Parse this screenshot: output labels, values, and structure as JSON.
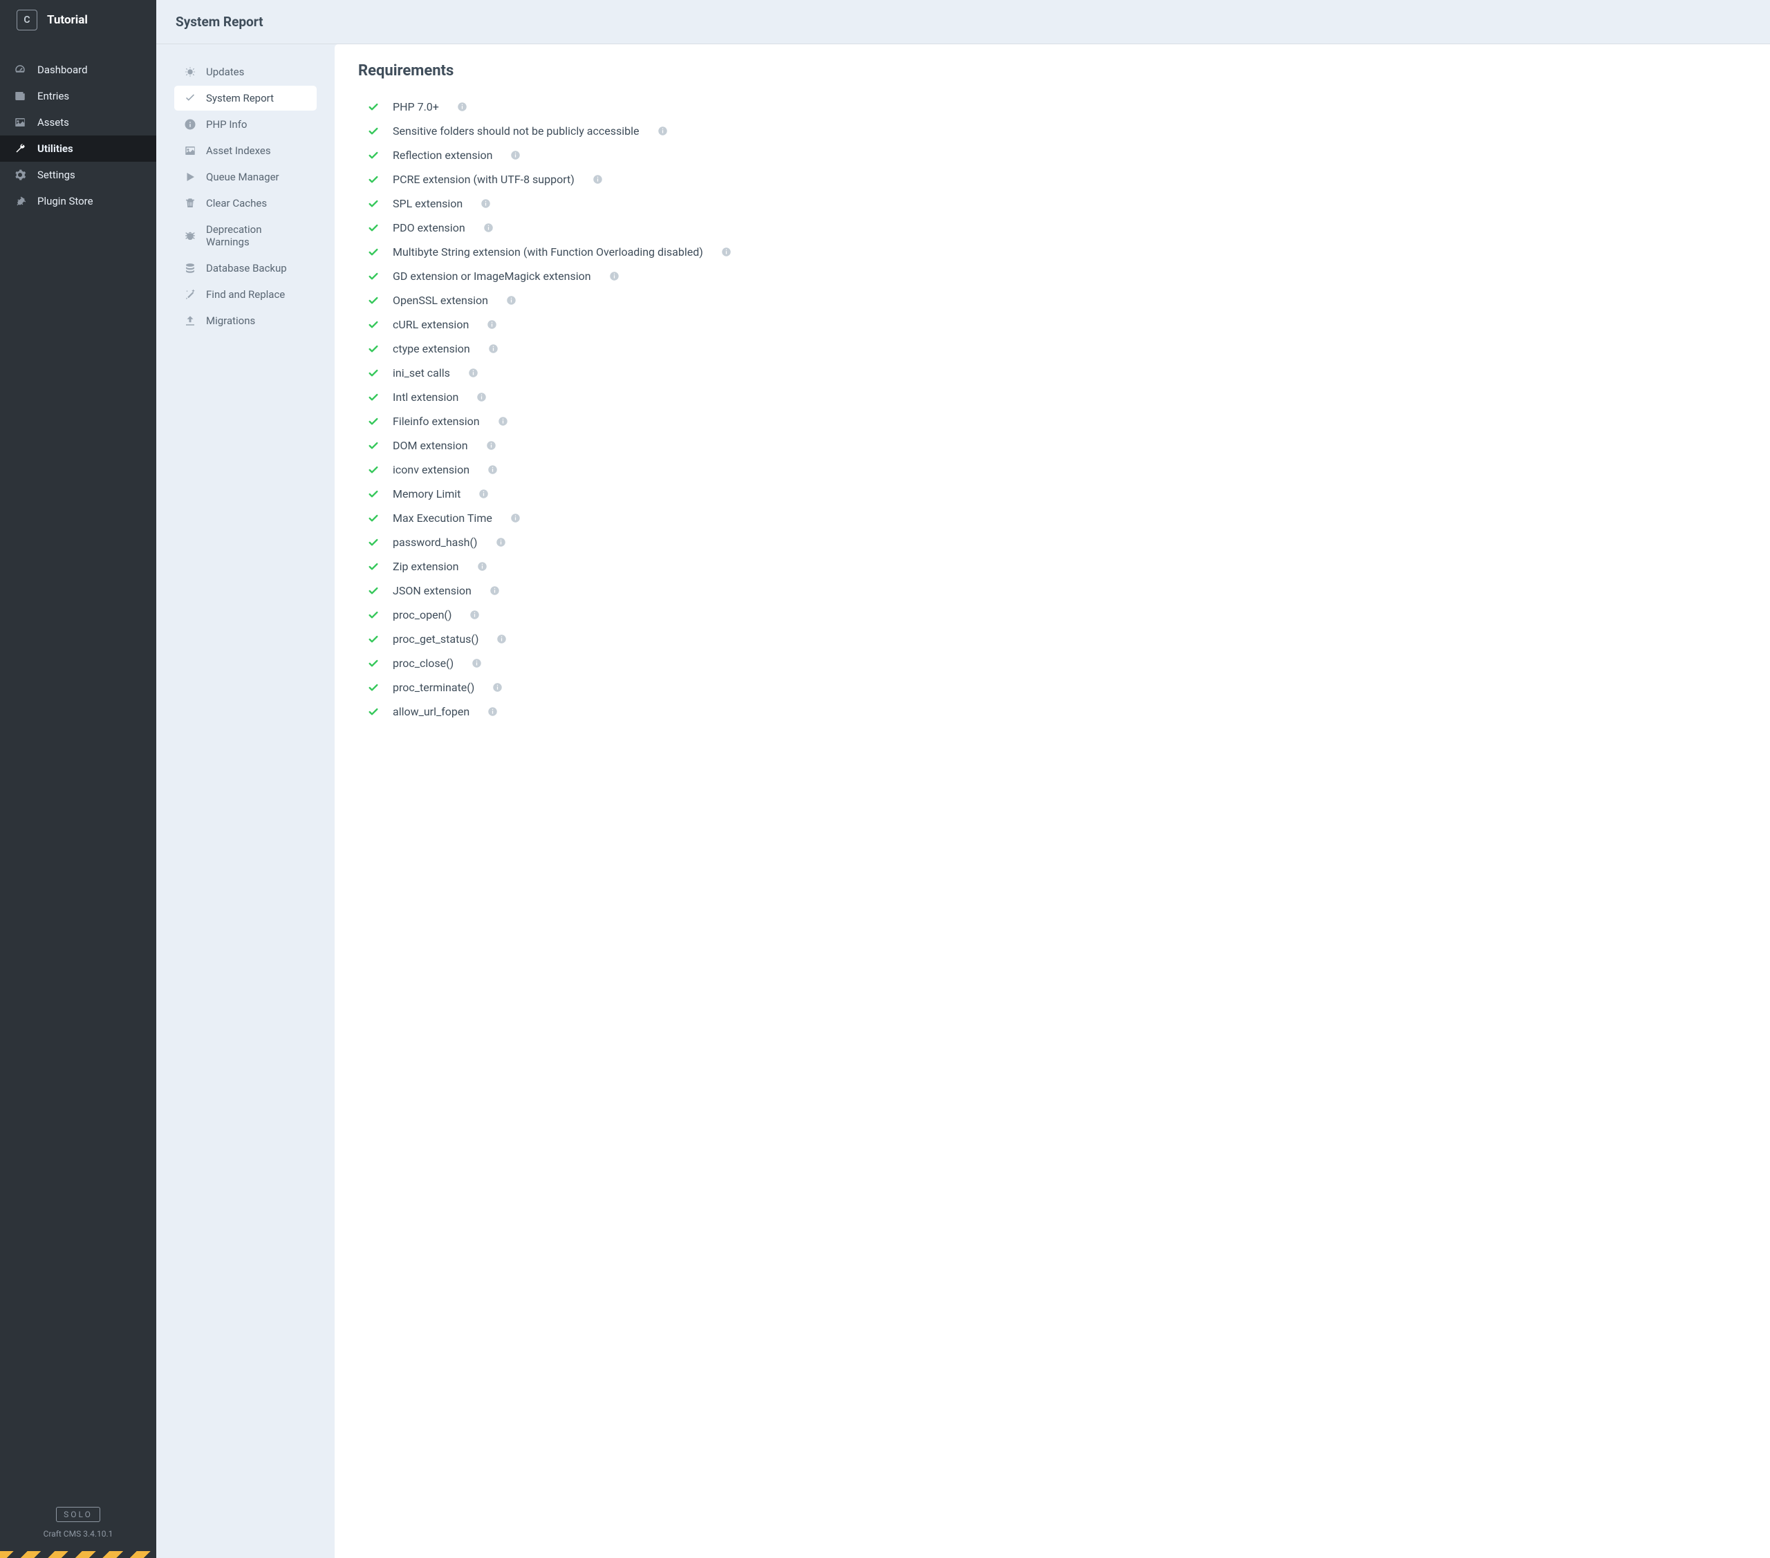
{
  "site": {
    "logo_letter": "C",
    "name": "Tutorial"
  },
  "nav": {
    "items": [
      {
        "label": "Dashboard",
        "icon": "gauge"
      },
      {
        "label": "Entries",
        "icon": "news"
      },
      {
        "label": "Assets",
        "icon": "image"
      },
      {
        "label": "Utilities",
        "icon": "wrench",
        "active": true
      },
      {
        "label": "Settings",
        "icon": "gear"
      },
      {
        "label": "Plugin Store",
        "icon": "plug"
      }
    ]
  },
  "footer": {
    "edition": "SOLO",
    "version": "Craft CMS 3.4.10.1"
  },
  "page": {
    "title": "System Report"
  },
  "subnav": {
    "items": [
      {
        "label": "Updates",
        "icon": "sun"
      },
      {
        "label": "System Report",
        "icon": "check",
        "active": true
      },
      {
        "label": "PHP Info",
        "icon": "info"
      },
      {
        "label": "Asset Indexes",
        "icon": "image"
      },
      {
        "label": "Queue Manager",
        "icon": "play"
      },
      {
        "label": "Clear Caches",
        "icon": "trash"
      },
      {
        "label": "Deprecation Warnings",
        "icon": "bug"
      },
      {
        "label": "Database Backup",
        "icon": "database"
      },
      {
        "label": "Find and Replace",
        "icon": "wand"
      },
      {
        "label": "Migrations",
        "icon": "upload"
      }
    ]
  },
  "content": {
    "section_title": "Requirements",
    "requirements": [
      {
        "label": "PHP 7.0+",
        "ok": true
      },
      {
        "label": "Sensitive folders should not be publicly accessible",
        "ok": true
      },
      {
        "label": "Reflection extension",
        "ok": true
      },
      {
        "label": "PCRE extension (with UTF-8 support)",
        "ok": true
      },
      {
        "label": "SPL extension",
        "ok": true
      },
      {
        "label": "PDO extension",
        "ok": true
      },
      {
        "label": "Multibyte String extension (with Function Overloading disabled)",
        "ok": true
      },
      {
        "label": "GD extension or ImageMagick extension",
        "ok": true
      },
      {
        "label": "OpenSSL extension",
        "ok": true
      },
      {
        "label": "cURL extension",
        "ok": true
      },
      {
        "label": "ctype extension",
        "ok": true
      },
      {
        "label": "ini_set calls",
        "ok": true
      },
      {
        "label": "Intl extension",
        "ok": true
      },
      {
        "label": "Fileinfo extension",
        "ok": true
      },
      {
        "label": "DOM extension",
        "ok": true
      },
      {
        "label": "iconv extension",
        "ok": true
      },
      {
        "label": "Memory Limit",
        "ok": true
      },
      {
        "label": "Max Execution Time",
        "ok": true
      },
      {
        "label": "password_hash()",
        "ok": true
      },
      {
        "label": "Zip extension",
        "ok": true
      },
      {
        "label": "JSON extension",
        "ok": true
      },
      {
        "label": "proc_open()",
        "ok": true
      },
      {
        "label": "proc_get_status()",
        "ok": true
      },
      {
        "label": "proc_close()",
        "ok": true
      },
      {
        "label": "proc_terminate()",
        "ok": true
      },
      {
        "label": "allow_url_fopen",
        "ok": true
      }
    ]
  }
}
